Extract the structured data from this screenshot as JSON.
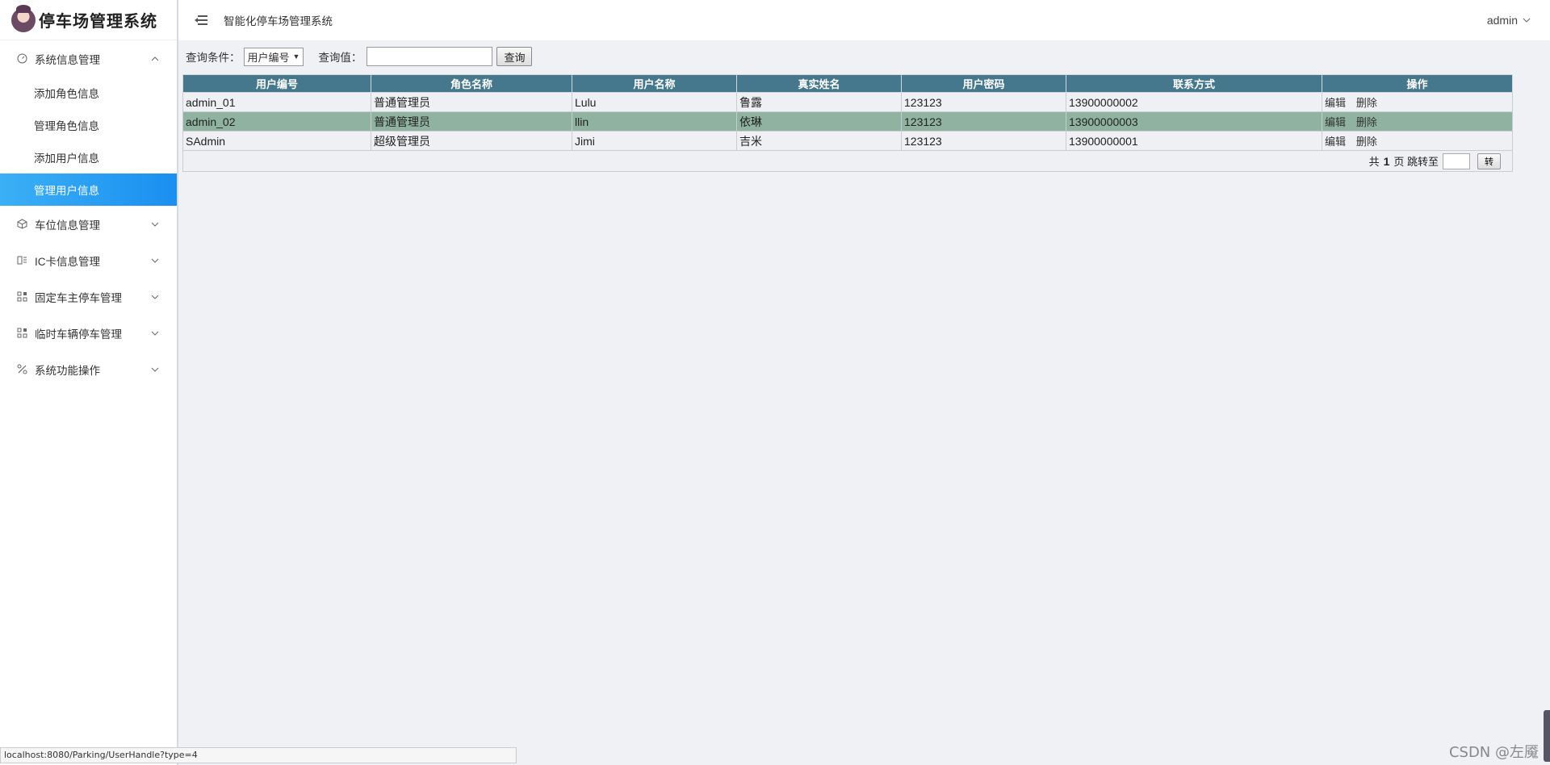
{
  "brand": {
    "title": "停车场管理系统"
  },
  "header": {
    "title": "智能化停车场管理系统",
    "user": "admin"
  },
  "sidebar": {
    "groups": [
      {
        "label": "系统信息管理",
        "icon": "dashboard-icon",
        "expanded": true,
        "items": [
          {
            "label": "添加角色信息"
          },
          {
            "label": "管理角色信息"
          },
          {
            "label": "添加用户信息"
          },
          {
            "label": "管理用户信息",
            "active": true
          }
        ]
      },
      {
        "label": "车位信息管理",
        "icon": "box-icon"
      },
      {
        "label": "IC卡信息管理",
        "icon": "card-icon"
      },
      {
        "label": "固定车主停车管理",
        "icon": "grid-icon"
      },
      {
        "label": "临时车辆停车管理",
        "icon": "grid-icon"
      },
      {
        "label": "系统功能操作",
        "icon": "tools-icon"
      }
    ]
  },
  "query": {
    "condition_label": "查询条件：",
    "condition_value": "用户编号",
    "value_label": "查询值：",
    "value": "",
    "button": "查询"
  },
  "table": {
    "headers": [
      "用户编号",
      "角色名称",
      "用户名称",
      "真实姓名",
      "用户密码",
      "联系方式",
      "操作"
    ],
    "rows": [
      {
        "id": "admin_01",
        "role": "普通管理员",
        "username": "Lulu",
        "realname": "鲁露",
        "password": "123123",
        "phone": "13900000002"
      },
      {
        "id": "admin_02",
        "role": "普通管理员",
        "username": "llin",
        "realname": "依琳",
        "password": "123123",
        "phone": "13900000003"
      },
      {
        "id": "SAdmin",
        "role": "超级管理员",
        "username": "Jimi",
        "realname": "吉米",
        "password": "123123",
        "phone": "13900000001"
      }
    ],
    "edit_label": "编辑",
    "delete_label": "删除"
  },
  "pager": {
    "prefix": "共",
    "pages": "1",
    "suffix": "页 跳转至",
    "button": "转"
  },
  "statusbar": {
    "url": "localhost:8080/Parking/UserHandle?type=4"
  },
  "watermark": "CSDN @左魇"
}
